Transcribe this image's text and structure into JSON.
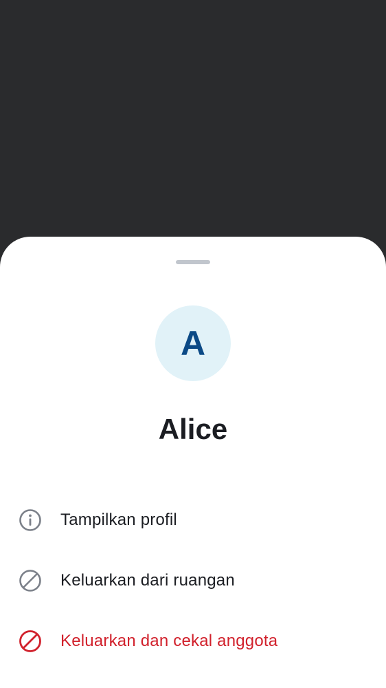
{
  "colors": {
    "scrim": "#2a2b2d",
    "sheet": "#ffffff",
    "avatar_bg": "#e1f2f8",
    "avatar_text": "#0b4a86",
    "text_primary": "#1b1d22",
    "icon_neutral": "#7b8089",
    "danger": "#d1212c"
  },
  "sheet": {
    "avatar": {
      "initial": "A"
    },
    "member_name": "Alice"
  },
  "menu": {
    "items": [
      {
        "label": "Tampilkan profil",
        "icon": "info-icon"
      },
      {
        "label": "Keluarkan dari ruangan",
        "icon": "block-icon"
      },
      {
        "label": "Keluarkan dan cekal anggota",
        "icon": "ban-icon"
      }
    ]
  }
}
